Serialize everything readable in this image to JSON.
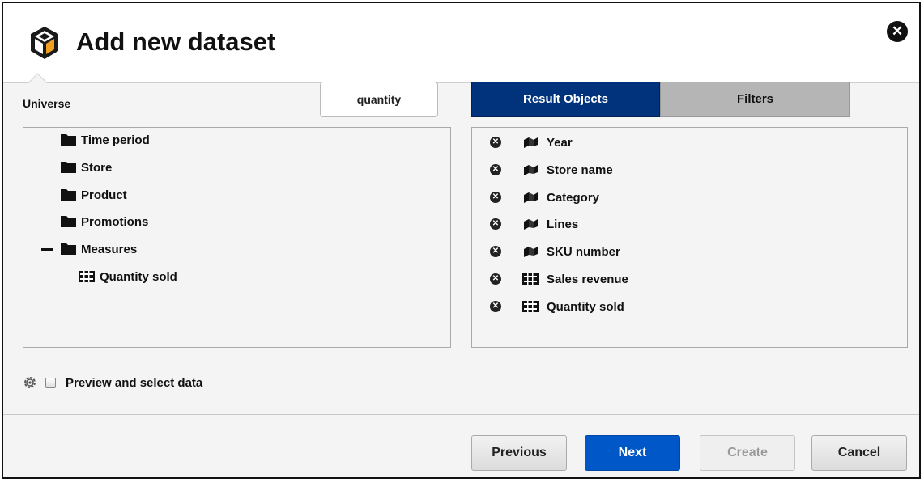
{
  "dialog": {
    "title": "Add new dataset",
    "close_icon": "close-icon"
  },
  "universe": {
    "label": "Universe",
    "search_value": "quantity",
    "tree": [
      {
        "label": "Time period",
        "icon": "folder-icon",
        "expanded": false
      },
      {
        "label": "Store",
        "icon": "folder-icon",
        "expanded": false
      },
      {
        "label": "Product",
        "icon": "folder-icon",
        "expanded": false
      },
      {
        "label": "Promotions",
        "icon": "folder-icon",
        "expanded": false
      },
      {
        "label": "Measures",
        "icon": "folder-icon",
        "expanded": true
      },
      {
        "label": "Quantity sold",
        "icon": "measure-icon"
      }
    ]
  },
  "tabs": [
    {
      "label": "Result Objects",
      "active": true
    },
    {
      "label": "Filters",
      "active": false
    }
  ],
  "result_objects": [
    {
      "label": "Year",
      "icon": "dimension-icon"
    },
    {
      "label": "Store name",
      "icon": "dimension-icon"
    },
    {
      "label": "Category",
      "icon": "dimension-icon"
    },
    {
      "label": "Lines",
      "icon": "dimension-icon"
    },
    {
      "label": "SKU number",
      "icon": "dimension-icon"
    },
    {
      "label": "Sales revenue",
      "icon": "measure-icon"
    },
    {
      "label": "Quantity sold",
      "icon": "measure-icon"
    }
  ],
  "preview": {
    "label": "Preview and select data",
    "checked": false
  },
  "buttons": {
    "previous": "Previous",
    "next": "Next",
    "create": "Create",
    "cancel": "Cancel"
  },
  "colors": {
    "tab_active": "#00337c",
    "tab_inactive": "#b5b5b5",
    "primary_button": "#0058c8"
  }
}
